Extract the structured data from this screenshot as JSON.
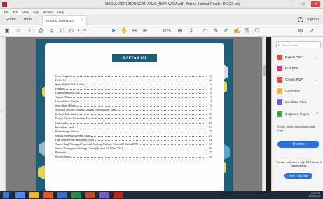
{
  "window": {
    "title": "MODUL PERLINDUNGAN ANAK_NOVI WIRA.pdf - Adobe Acrobat Reader DC (32-bit)",
    "minimize_glyph": "–",
    "maximize_glyph": "□",
    "close_glyph": "✕"
  },
  "menubar": [
    "File",
    "Edit",
    "View",
    "Sign",
    "Window",
    "Help"
  ],
  "tabs": {
    "home": "Home",
    "tools": "Tools",
    "doc": "MODUL_PERLIND...",
    "close": "×",
    "help": "?",
    "signin": "Sign In"
  },
  "toolbar": {
    "page_value": "1",
    "page_total": "/ 16",
    "zoom": "99,7%",
    "icons": [
      "save-icon",
      "bookmark-icon",
      "upload-icon",
      "print-icon",
      "search-icon",
      "page-up-icon",
      "page-down-icon",
      "select-cursor-icon",
      "hand-icon",
      "zoom-out-icon",
      "zoom-in-icon",
      "fit-page-icon",
      "scroll-mode-icon",
      "comment-icon",
      "highlight-icon",
      "pen-icon",
      "sign-icon",
      "stamp-icon",
      "share-icon",
      "mail-icon"
    ]
  },
  "document": {
    "heading": "DAFTAR ISI",
    "toc": [
      {
        "label": "Kata Pengantar",
        "page": "ii"
      },
      {
        "label": "Daftar Isi",
        "page": "iii"
      },
      {
        "label": "Sejarah Suka Wisa Kartika",
        "page": "1"
      },
      {
        "label": "Hukum",
        "page": "2"
      },
      {
        "label": "Hukum Menurut Ahli",
        "page": "2"
      },
      {
        "label": "Tujuan Hukum",
        "page": "3"
      },
      {
        "label": "Unsur-Unsur Hukum",
        "page": "3"
      },
      {
        "label": "Jenis-Jenis Hukum",
        "page": "5"
      },
      {
        "label": "Sejarah Lahirnya Undang Undang Perlindungan Anak",
        "page": "7"
      },
      {
        "label": "Definisi Hak Anak",
        "page": "10"
      },
      {
        "label": "Prinsip Umum Pemenuhan Hak Anak",
        "page": "11"
      },
      {
        "label": "Hak Anak",
        "page": "11"
      },
      {
        "label": "Kewajiban Anak",
        "page": "11"
      },
      {
        "label": "Perlindungan Khusus",
        "page": "12"
      },
      {
        "label": "Bentuk Pelanggaran Hak Anak",
        "page": "13"
      },
      {
        "label": "Hak Anak Ketika Menjadi Korban",
        "page": "13"
      },
      {
        "label": "Sanksi Bagi Pelanggar Hak Anak Undang Undang Nomor 23 Tahun 2002",
        "page": "13"
      },
      {
        "label": "Sanksi Pelanggaran Undang Undang Nomor 35 Tahun 2014",
        "page": "16"
      },
      {
        "label": "Referensi",
        "page": "17"
      },
      {
        "label": "Profil Penulis",
        "page": "18"
      }
    ]
  },
  "right_panel": {
    "search_placeholder": "Search Tools",
    "items": [
      {
        "label": "Export PDF",
        "icon": "export-pdf-icon",
        "color": "#e0523a",
        "chevron": "⌄"
      },
      {
        "label": "Edit PDF",
        "icon": "edit-pdf-icon",
        "color": "#d6376f",
        "chevron": ""
      },
      {
        "label": "Create PDF",
        "icon": "create-pdf-icon",
        "color": "#e0523a",
        "chevron": "⌄"
      },
      {
        "label": "Comment",
        "icon": "comment-icon",
        "color": "#f1b82e",
        "chevron": ""
      },
      {
        "label": "Combine Files",
        "icon": "combine-files-icon",
        "color": "#6b5bd6",
        "chevron": ""
      },
      {
        "label": "Organize Pages",
        "icon": "organize-pages-icon",
        "color": "#3fa14a",
        "chevron": "^"
      }
    ],
    "organize_desc": "Delete, insert, extract and rotate pages.",
    "try_now": "Try now",
    "create_edit": "Create, edit, and e-sign PDF forms & agreements",
    "free_trial": "Free 7-Day Trial"
  },
  "taskbar": {
    "time": "4:50 PM",
    "date": "9/21/2021"
  },
  "colors": {
    "page_teal": "#1f5f7c",
    "accent_blue": "#2a72d8",
    "taskbar": "#1d2a38"
  }
}
